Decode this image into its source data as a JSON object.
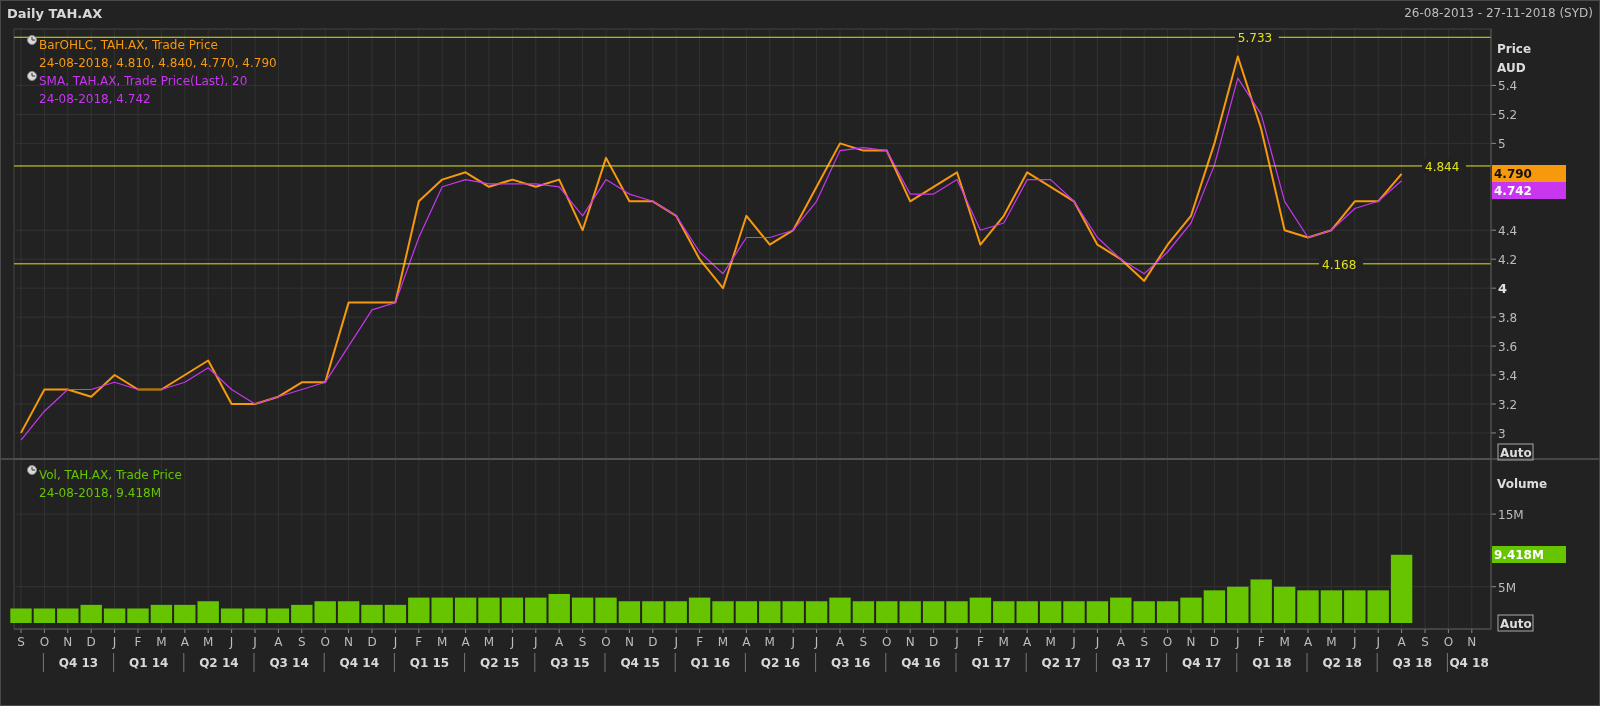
{
  "window": {
    "title": "Daily TAH.AX",
    "date_range": "26-08-2013 - 27-11-2018 (SYD)"
  },
  "price_panel": {
    "axis_title": "Price",
    "axis_unit": "AUD",
    "auto_button": "Auto",
    "legend_values": [
      "24-08-2018, 4.810, 4.840, 4.770, 4.790",
      "24-08-2018, 4.742"
    ],
    "badges": [
      {
        "label": "4.790",
        "color": "#f7990c"
      },
      {
        "label": "4.742",
        "color": "#c836f0"
      }
    ],
    "chart_data": {
      "type": "line",
      "grid": true,
      "series": [
        {
          "name": "BarOHLC, TAH.AX, Trade Price",
          "color": "#f7990c",
          "values": [
            3.0,
            3.3,
            3.3,
            3.25,
            3.4,
            3.3,
            3.3,
            3.4,
            3.5,
            3.2,
            3.2,
            3.25,
            3.35,
            3.35,
            3.9,
            3.9,
            3.9,
            4.6,
            4.75,
            4.8,
            4.7,
            4.75,
            4.7,
            4.75,
            4.4,
            4.9,
            4.6,
            4.6,
            4.5,
            4.2,
            4.0,
            4.5,
            4.3,
            4.4,
            4.7,
            5.0,
            4.95,
            4.95,
            4.6,
            4.7,
            4.8,
            4.3,
            4.5,
            4.8,
            4.7,
            4.6,
            4.3,
            4.2,
            4.05,
            4.3,
            4.5,
            5.0,
            5.6,
            5.1,
            4.4,
            4.35,
            4.4,
            4.6,
            4.6,
            4.79,
            null,
            null,
            null
          ]
        },
        {
          "name": "SMA, TAH.AX, Trade Price(Last),  20",
          "color": "#c836f0",
          "values": [
            2.95,
            3.15,
            3.3,
            3.3,
            3.35,
            3.3,
            3.3,
            3.35,
            3.45,
            3.3,
            3.2,
            3.25,
            3.3,
            3.35,
            3.6,
            3.85,
            3.9,
            4.35,
            4.7,
            4.75,
            4.72,
            4.72,
            4.72,
            4.7,
            4.5,
            4.75,
            4.65,
            4.6,
            4.5,
            4.25,
            4.1,
            4.35,
            4.35,
            4.4,
            4.6,
            4.95,
            4.97,
            4.95,
            4.65,
            4.65,
            4.75,
            4.4,
            4.45,
            4.75,
            4.75,
            4.6,
            4.35,
            4.2,
            4.1,
            4.25,
            4.45,
            4.85,
            5.45,
            5.2,
            4.6,
            4.35,
            4.4,
            4.55,
            4.6,
            4.742,
            null,
            null,
            null
          ]
        }
      ],
      "ylim": [
        2.82,
        5.79
      ],
      "yticks": [
        {
          "value": 3,
          "label": "3"
        },
        {
          "value": 3.2,
          "label": "3.2"
        },
        {
          "value": 3.4,
          "label": "3.4"
        },
        {
          "value": 3.6,
          "label": "3.6"
        },
        {
          "value": 3.8,
          "label": "3.8"
        },
        {
          "value": 4,
          "label": "4"
        },
        {
          "value": 4.2,
          "label": "4.2"
        },
        {
          "value": 4.4,
          "label": "4.4"
        },
        {
          "value": 5,
          "label": "5"
        },
        {
          "value": 5.2,
          "label": "5.2"
        },
        {
          "value": 5.4,
          "label": "5.4"
        }
      ],
      "ref_lines": [
        {
          "axis": "y",
          "value": 5.733,
          "label": "5.733"
        },
        {
          "axis": "y",
          "value": 4.844,
          "label": "4.844"
        },
        {
          "axis": "y",
          "value": 4.168,
          "label": "4.168"
        }
      ]
    }
  },
  "volume_panel": {
    "axis_title": "Volume",
    "auto_button": "Auto",
    "legend_values": [
      "24-08-2018, 9.418M"
    ],
    "badges": [
      {
        "label": "9.418M",
        "color": "#66c400"
      }
    ],
    "chart_data": {
      "type": "bar",
      "grid": true,
      "categories": [
        "S",
        "O",
        "N",
        "D",
        "J",
        "F",
        "M",
        "A",
        "M",
        "J",
        "J",
        "A",
        "S",
        "O",
        "N",
        "D",
        "J",
        "F",
        "M",
        "A",
        "M",
        "J",
        "J",
        "A",
        "S",
        "O",
        "N",
        "D",
        "J",
        "F",
        "M",
        "A",
        "M",
        "J",
        "J",
        "A",
        "S",
        "O",
        "N",
        "D",
        "J",
        "F",
        "M",
        "A",
        "M",
        "J",
        "J",
        "A",
        "S",
        "O",
        "N",
        "D",
        "J",
        "F",
        "M",
        "A",
        "M",
        "J",
        "J",
        "A",
        "S",
        "O",
        "N"
      ],
      "series": [
        {
          "name": "Vol, TAH.AX, Trade Price",
          "color": "#66c400",
          "values": [
            2,
            2,
            2,
            2.5,
            2,
            2,
            2.5,
            2.5,
            3,
            2,
            2,
            2,
            2.5,
            3,
            3,
            2.5,
            2.5,
            3.5,
            3.5,
            3.5,
            3.5,
            3.5,
            3.5,
            4,
            3.5,
            3.5,
            3,
            3,
            3,
            3.5,
            3,
            3,
            3,
            3,
            3,
            3.5,
            3,
            3,
            3,
            3,
            3,
            3.5,
            3,
            3,
            3,
            3,
            3,
            3.5,
            3,
            3,
            3.5,
            4.5,
            5,
            6,
            5,
            4.5,
            4.5,
            4.5,
            4.5,
            9.4,
            null,
            null,
            null
          ]
        }
      ],
      "ylim": [
        0,
        22.6
      ],
      "yticks": [
        {
          "value": 5,
          "label": "5M"
        },
        {
          "value": 15,
          "label": "15M"
        }
      ]
    }
  },
  "x_axis": {
    "quarters": [
      "Q4 13",
      "Q1 14",
      "Q2 14",
      "Q3 14",
      "Q4 14",
      "Q1 15",
      "Q2 15",
      "Q3 15",
      "Q4 15",
      "Q1 16",
      "Q2 16",
      "Q3 16",
      "Q4 16",
      "Q1 17",
      "Q2 17",
      "Q3 17",
      "Q4 17",
      "Q1 18",
      "Q2 18",
      "Q3 18",
      "Q4 18"
    ]
  }
}
